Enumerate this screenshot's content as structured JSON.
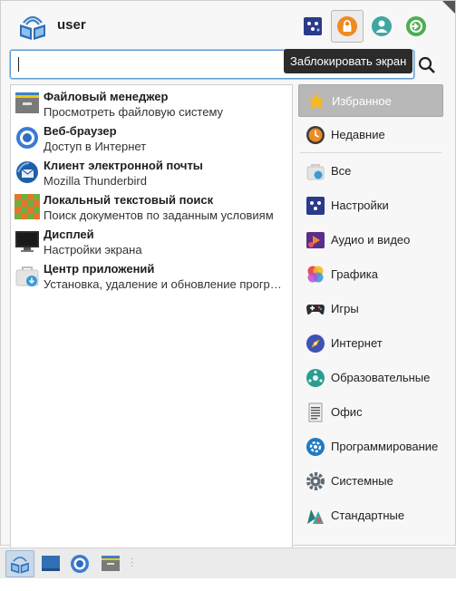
{
  "header": {
    "user_name": "user",
    "buttons": [
      {
        "name": "settings",
        "icon": "settings-icon"
      },
      {
        "name": "lock-screen",
        "icon": "lock-icon",
        "active": true
      },
      {
        "name": "user-account",
        "icon": "user-icon"
      },
      {
        "name": "logout",
        "icon": "logout-icon"
      }
    ],
    "tooltip": "Заблокировать экран"
  },
  "search": {
    "value": "",
    "placeholder": ""
  },
  "apps": [
    {
      "title": "Файловый менеджер",
      "desc": "Просмотреть файловую систему",
      "icon": "file-manager-icon"
    },
    {
      "title": "Веб-браузер",
      "desc": "Доступ в Интернет",
      "icon": "web-browser-icon"
    },
    {
      "title": "Клиент электронной почты",
      "desc": "Mozilla Thunderbird",
      "icon": "thunderbird-icon"
    },
    {
      "title": "Локальный текстовый поиск",
      "desc": "Поиск документов по заданным условиям",
      "icon": "text-search-icon"
    },
    {
      "title": "Дисплей",
      "desc": "Настройки экрана",
      "icon": "display-icon"
    },
    {
      "title": "Центр приложений",
      "desc": "Установка, удаление и обновление программ",
      "icon": "app-center-icon"
    }
  ],
  "categories": [
    {
      "label": "Избранное",
      "icon": "star-icon",
      "selected": true
    },
    {
      "label": "Недавние",
      "icon": "recent-icon"
    },
    {
      "label": "Все",
      "icon": "all-apps-icon"
    },
    {
      "label": "Настройки",
      "icon": "settings-category-icon"
    },
    {
      "label": "Аудио и видео",
      "icon": "multimedia-icon"
    },
    {
      "label": "Графика",
      "icon": "graphics-icon"
    },
    {
      "label": "Игры",
      "icon": "gamepad-icon"
    },
    {
      "label": "Интернет",
      "icon": "internet-icon"
    },
    {
      "label": "Образовательные",
      "icon": "education-icon"
    },
    {
      "label": "Офис",
      "icon": "office-icon"
    },
    {
      "label": "Программирование",
      "icon": "programming-icon"
    },
    {
      "label": "Системные",
      "icon": "system-icon"
    },
    {
      "label": "Стандартные",
      "icon": "accessories-icon"
    }
  ],
  "taskbar": [
    {
      "name": "menu",
      "icon": "menu-book-icon",
      "active": true
    },
    {
      "name": "desktop",
      "icon": "desktop-icon"
    },
    {
      "name": "browser",
      "icon": "browser-icon"
    },
    {
      "name": "files",
      "icon": "files-icon"
    }
  ],
  "colors": {
    "accent": "#5b9bd5",
    "lock": "#f08a24",
    "selection": "#b8b8b8"
  }
}
